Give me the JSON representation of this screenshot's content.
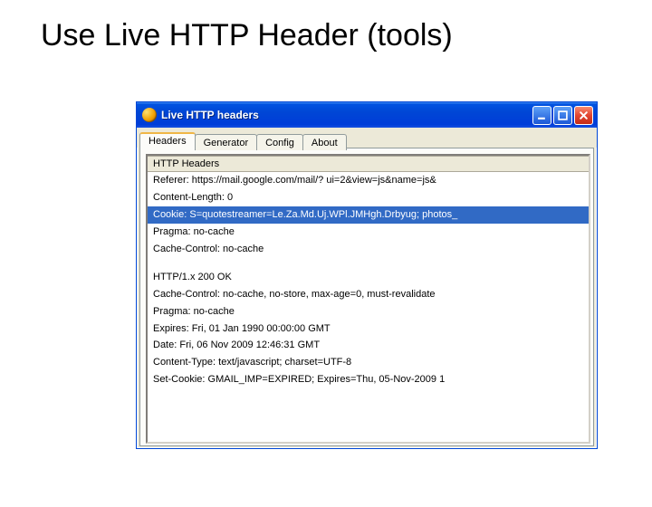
{
  "slide": {
    "title": "Use Live HTTP Header (tools)"
  },
  "window": {
    "title": "Live HTTP headers",
    "tabs": [
      "Headers",
      "Generator",
      "Config",
      "About"
    ],
    "active_tab": 0,
    "section_label": "HTTP Headers",
    "request_lines": [
      "Referer: https://mail.google.com/mail/? ui=2&view=js&name=js&",
      "Content-Length: 0",
      "Cookie: S=quotestreamer=Le.Za.Md.Uj.WPl.JMHgh.Drbyug; photos_",
      "Pragma: no-cache",
      "Cache-Control: no-cache"
    ],
    "selected_request_index": 2,
    "response_lines": [
      "HTTP/1.x 200 OK",
      "Cache-Control: no-cache, no-store, max-age=0, must-revalidate",
      "Pragma: no-cache",
      "Expires: Fri, 01 Jan 1990 00:00:00 GMT",
      "Date: Fri, 06 Nov 2009 12:46:31 GMT",
      "Content-Type: text/javascript; charset=UTF-8",
      "Set-Cookie: GMAIL_IMP=EXPIRED; Expires=Thu, 05-Nov-2009 1"
    ]
  }
}
